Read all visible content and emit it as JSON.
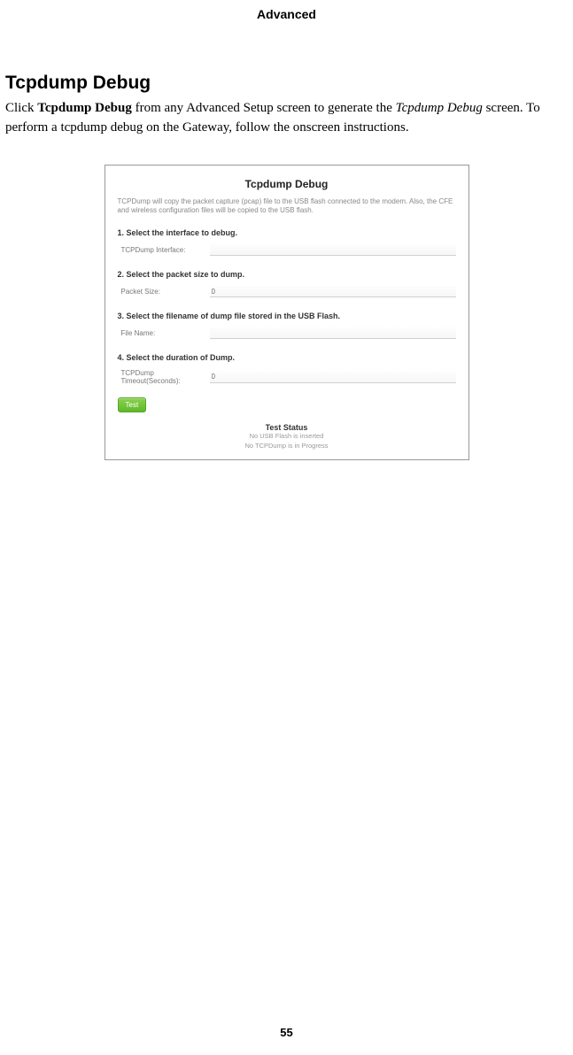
{
  "page": {
    "header": "Advanced",
    "number": "55"
  },
  "section": {
    "title": "Tcpdump Debug",
    "para_prefix": "Click ",
    "para_bold": "Tcpdump Debug",
    "para_mid": " from any Advanced Setup screen to generate the ",
    "para_italic": "Tcpdump Debug",
    "para_suffix": " screen. To perform a tcpdump debug on the Gateway, follow the onscreen instructions."
  },
  "screenshot": {
    "title": "Tcpdump Debug",
    "description": "TCPDump will copy the packet capture (pcap) file to the USB flash connected to the modem. Also, the CFE and wireless configuration files will be copied to the USB flash.",
    "steps": {
      "s1": "1. Select the interface to debug.",
      "s2": "2. Select the packet size to dump.",
      "s3": "3. Select the filename of dump file stored in the USB Flash.",
      "s4": "4. Select the duration of Dump."
    },
    "fields": {
      "interface_label": "TCPDump Interface:",
      "interface_value": "",
      "packet_label": "Packet Size:",
      "packet_value": "0",
      "filename_label": "File Name:",
      "filename_value": "",
      "timeout_label": "TCPDump Timeout(Seconds):",
      "timeout_value": "0"
    },
    "test_button": "Test",
    "status": {
      "title": "Test Status",
      "line1": "No USB Flash is inserted",
      "line2": "No TCPDump is in Progress"
    }
  }
}
